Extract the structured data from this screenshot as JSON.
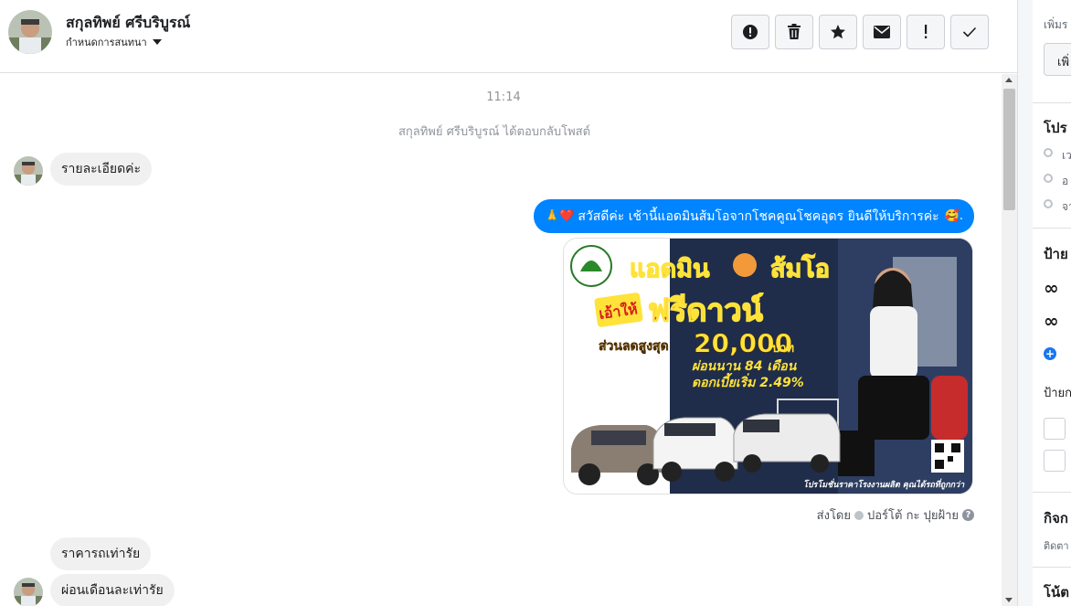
{
  "header": {
    "contact_name": "สกุลทิพย์ ศรีบริบูรณ์",
    "assign_label": "กำหนดการสนทนา",
    "toolbar": [
      "spam-icon",
      "trash-icon",
      "star-icon",
      "envelope-icon",
      "exclamation-icon",
      "check-icon"
    ]
  },
  "thread": {
    "timestamp": "11:14",
    "reply_note": "สกุลทิพย์ ศรีบริบูรณ์ ได้ตอบกลับโพสต์",
    "messages": [
      {
        "direction": "in",
        "text": "รายละเอียดค่ะ"
      },
      {
        "direction": "out",
        "emoji_prefix": "🙏❤️",
        "text": "สวัสดีค่ะ เช้านี้แอดมินส้มโอจากโชคคูณโชคอุดร ยินดีให้บริการค่ะ",
        "emoji_suffix": "🥰."
      },
      {
        "direction": "in",
        "text": "ราคารถเท่ารัย"
      },
      {
        "direction": "in",
        "text": "ผ่อนเดือนละเท่ารัย"
      }
    ],
    "ad": {
      "title_left": "แอดมิน",
      "title_right": "ส้มโอ",
      "badge": "เอ้าให้",
      "headline": "ฟรีดาวน์",
      "discount_label": "ส่วนลดสูงสุด",
      "discount_value": "20,000",
      "discount_unit": "บาท",
      "installment": "ผ่อนนาน 84 เดือน",
      "interest": "ดอกเบี้ยเริ่ม 2.49%",
      "footer": "โปรโมชั่นราคาโรงงานผลิต คุณได้รถที่ถูกกว่า"
    },
    "sent_by_label": "ส่งโดย",
    "sent_by_name": "ปอร์โต้ กะ ปุยฝ้าย"
  },
  "right_panel": {
    "add_label": "เพิ่มร",
    "add_input": "เพิ่",
    "profile_heading": "โปร",
    "profile_rows": [
      "เว",
      "อ",
      "จา"
    ],
    "labels_heading": "ป้าย",
    "labels_sub": "ป้ายก",
    "activity_heading": "กิจก",
    "activity_sub": "ติดตา",
    "notes_heading": "โน้ต"
  }
}
